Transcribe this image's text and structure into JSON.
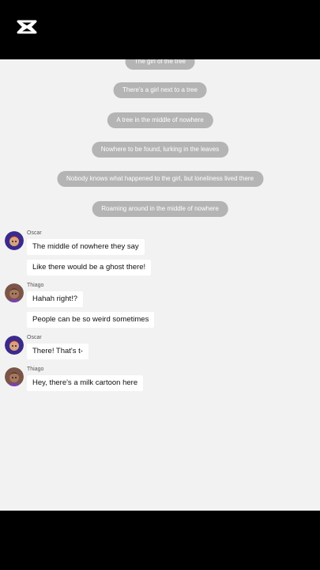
{
  "narrations": [
    "The girl of the tree",
    "There's a girl next to a tree",
    "A tree in the middle of nowhere",
    "Nowhere to be found, lurking in the leaves",
    "Nobody knows what happened to the girl, but loneliness lived there",
    "Roaming around in the middle of nowhere"
  ],
  "messages": [
    {
      "sender": "Oscar",
      "lines": [
        "The middle of nowhere they say",
        "Like there would be a ghost there!"
      ]
    },
    {
      "sender": "Thiago",
      "lines": [
        "Hahah right!?",
        "People can be so weird sometimes"
      ]
    },
    {
      "sender": "Oscar",
      "lines": [
        "There! That's t-"
      ]
    },
    {
      "sender": "Thiago",
      "lines": [
        "Hey, there's a milk cartoon here"
      ]
    }
  ],
  "colors": {
    "background": "#f2f2f2",
    "narration_pill": "#b4b4b4",
    "bubble": "#ffffff",
    "letterbox": "#000000",
    "oscar_avatar": "#3a2a8c",
    "thiago_avatar": "#7a5548"
  },
  "icons": {
    "logo": "capcut-logo-icon",
    "oscar": "avatar-oscar",
    "thiago": "avatar-thiago"
  }
}
